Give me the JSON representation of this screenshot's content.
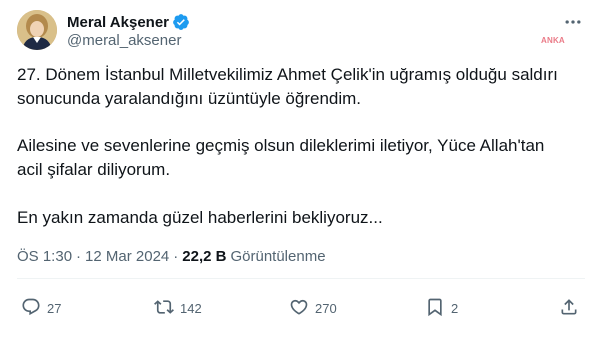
{
  "author": {
    "display_name": "Meral Akşener",
    "handle": "@meral_aksener"
  },
  "watermark": "ANKA",
  "tweet": {
    "paragraph1_line1": "27. Dönem İstanbul Milletvekilimiz Ahmet Çelik'in uğramış olduğu saldırı",
    "paragraph1_line2": "sonucunda yaralandığını üzüntüyle öğrendim.",
    "paragraph2_line1": "Ailesine ve sevenlerine geçmiş olsun dileklerimi iletiyor, Yüce Allah'tan",
    "paragraph2_line2": "acil şifalar diliyorum.",
    "paragraph3": "En yakın zamanda güzel haberlerini bekliyoruz..."
  },
  "meta": {
    "time": "ÖS 1:30",
    "separator": "·",
    "date": "12 Mar 2024",
    "views_count": "22,2 B",
    "views_label": "Görüntülenme"
  },
  "actions": {
    "replies": "27",
    "reposts": "142",
    "likes": "270",
    "bookmarks": "2"
  },
  "colors": {
    "verified_badge": "#1d9bf0",
    "secondary_text": "#536471",
    "primary_text": "#0f1419"
  },
  "icons": [
    "verified-badge-icon",
    "more-icon",
    "reply-icon",
    "repost-icon",
    "like-icon",
    "bookmark-icon",
    "share-icon"
  ]
}
